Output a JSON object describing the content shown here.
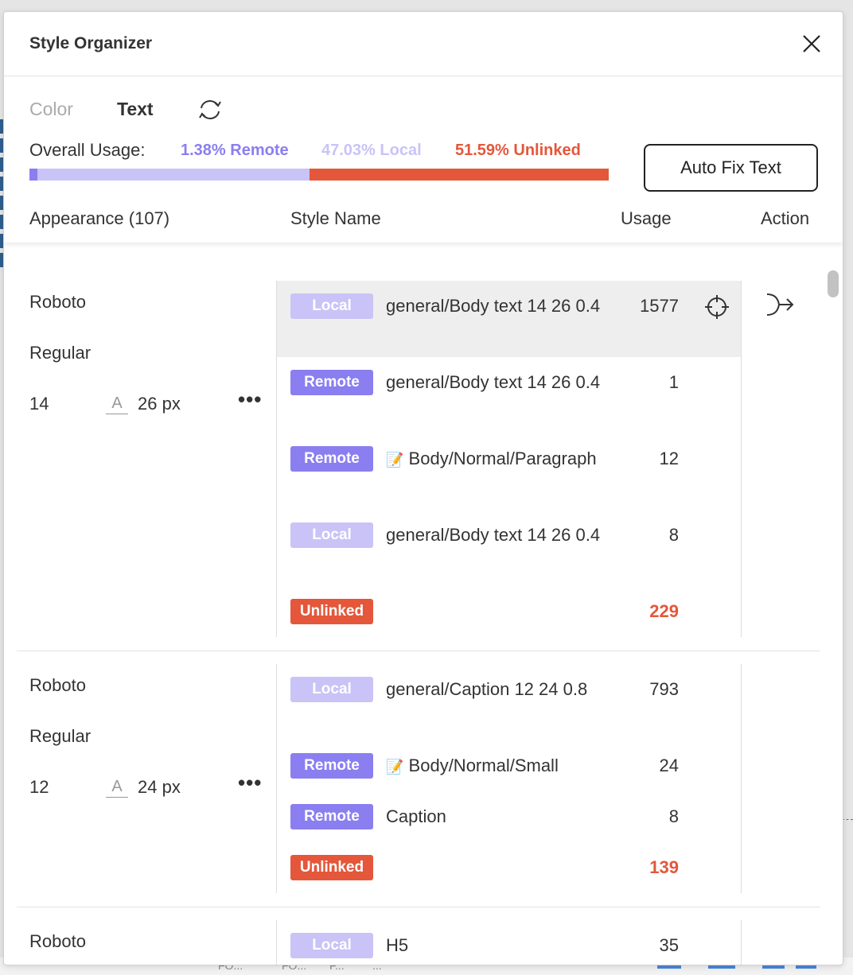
{
  "panel": {
    "title": "Style Organizer"
  },
  "tabs": [
    {
      "label": "Color"
    },
    {
      "label": "Text"
    }
  ],
  "usage": {
    "label": "Overall Usage:",
    "remote": "1.38% Remote",
    "local": "47.03% Local",
    "unlinked": "51.59% Unlinked",
    "remote_fraction": 0.0138,
    "local_fraction": 0.4703,
    "unlinked_fraction": 0.5159
  },
  "auto_fix_label": "Auto Fix Text",
  "headers": {
    "appearance": "Appearance (107)",
    "style_name": "Style Name",
    "usage": "Usage",
    "action": "Action"
  },
  "colors": {
    "remote": "#8a7ef0",
    "local": "#c9c3f7",
    "unlinked": "#e4573a"
  },
  "groups": [
    {
      "font": "Roboto",
      "weight": "Regular",
      "size": "14",
      "line_height": "26 px",
      "styles": [
        {
          "badge": "Local",
          "name": "general/Body text 14 26 0.4",
          "count": "1577"
        },
        {
          "badge": "Remote",
          "name": "general/Body text 14 26 0.4",
          "count": "1"
        },
        {
          "badge": "Remote",
          "emoji": "📝",
          "name": "Body/Normal/Paragraph",
          "count": "12"
        },
        {
          "badge": "Local",
          "name": "general/Body text 14 26 0.4",
          "count": "8"
        },
        {
          "badge": "Unlinked",
          "name": "",
          "count": "229"
        }
      ]
    },
    {
      "font": "Roboto",
      "weight": "Regular",
      "size": "12",
      "line_height": "24 px",
      "styles": [
        {
          "badge": "Local",
          "name": "general/Caption 12 24 0.8",
          "count": "793"
        },
        {
          "badge": "Remote",
          "emoji": "📝",
          "name": "Body/Normal/Small",
          "count": "24"
        },
        {
          "badge": "Remote",
          "name": "Caption",
          "count": "8"
        },
        {
          "badge": "Unlinked",
          "name": "",
          "count": "139"
        }
      ]
    },
    {
      "font": "Roboto",
      "styles": [
        {
          "badge": "Local",
          "name": "H5",
          "count": "35"
        }
      ]
    }
  ],
  "background_fragments": [
    "FO...",
    "FO...",
    "F...",
    "..."
  ]
}
